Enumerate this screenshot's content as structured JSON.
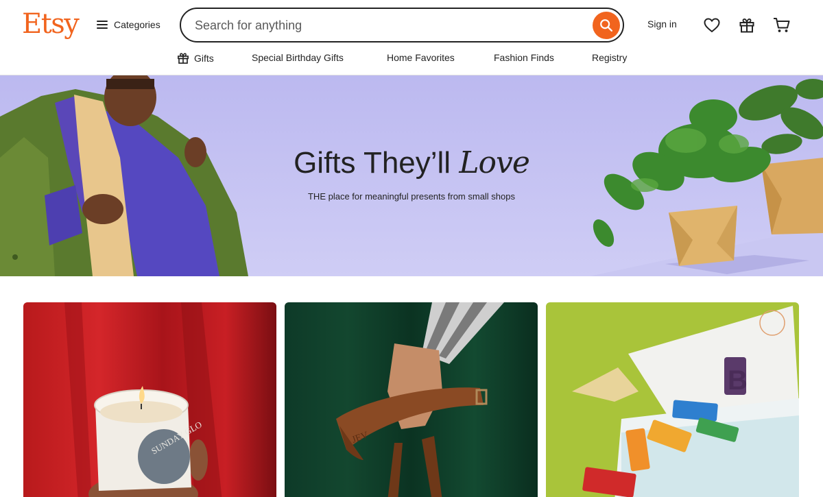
{
  "logo": "Etsy",
  "categories_label": "Categories",
  "search": {
    "placeholder": "Search for anything"
  },
  "signin_label": "Sign in",
  "subnav": [
    "Gifts",
    "Special Birthday Gifts",
    "Home Favorites",
    "Fashion Finds",
    "Registry"
  ],
  "hero": {
    "title_main": "Gifts They’ll",
    "title_italic": "Love",
    "subtitle": "THE place for meaningful presents from small shops"
  },
  "cards": {
    "candle_label": "SUNDAY GLO",
    "strap_monogram": "JEV",
    "blocks_letter": "B"
  },
  "colors": {
    "brand_orange": "#f1641e",
    "hero_bg": "#bfbdf1"
  },
  "icons": [
    "hamburger-icon",
    "search-icon",
    "heart-icon",
    "gift-icon",
    "cart-icon"
  ]
}
